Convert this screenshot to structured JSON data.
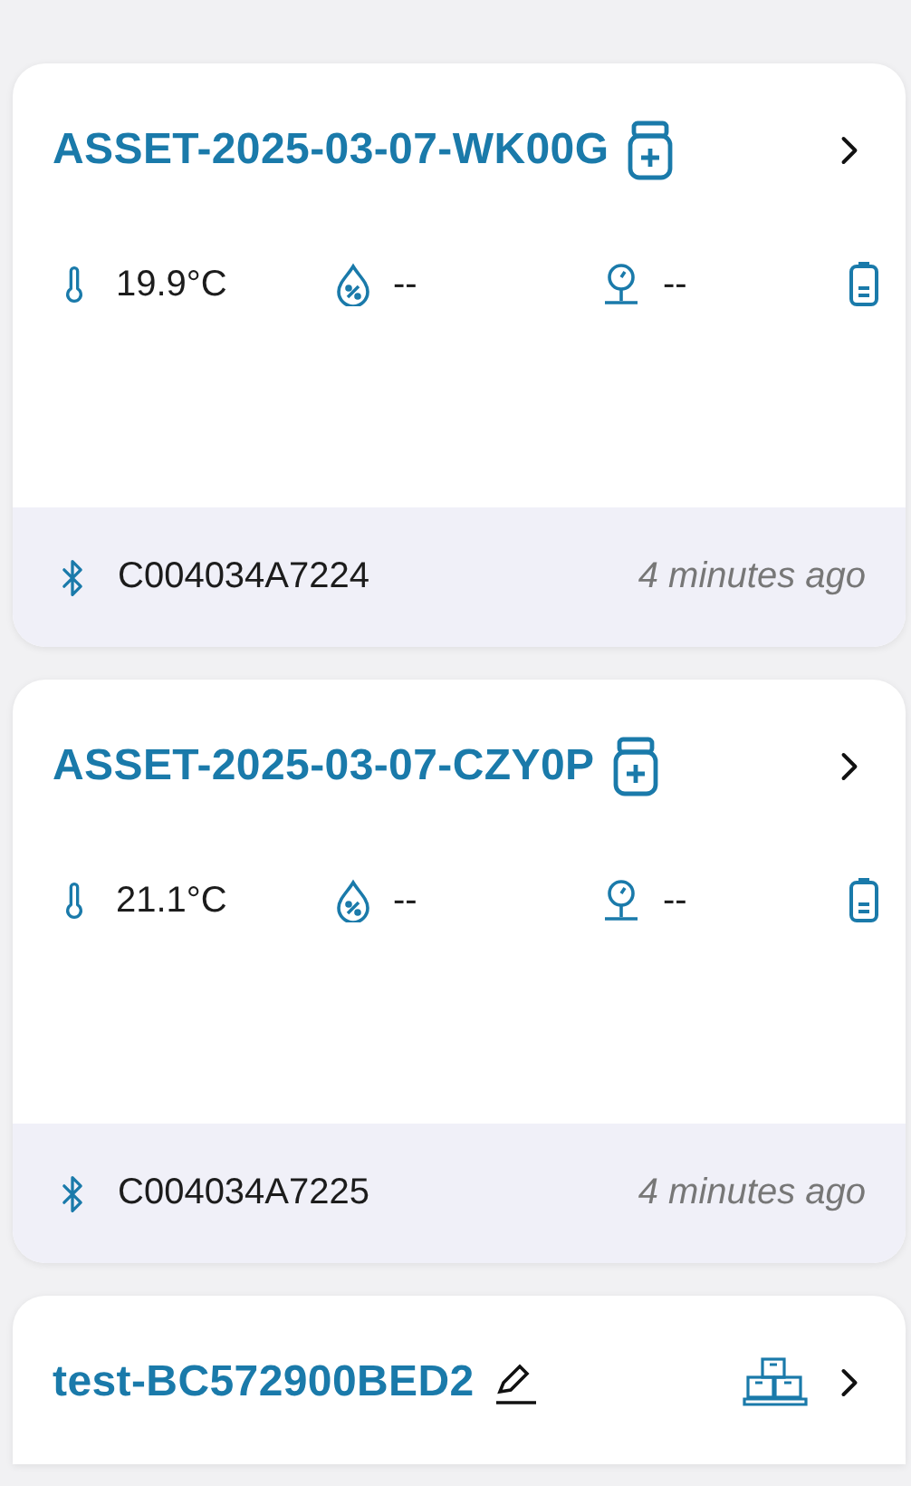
{
  "cards": [
    {
      "kind": "asset",
      "title": "ASSET-2025-03-07-WK00G",
      "sensors": [
        {
          "kind": "temperature",
          "value": "19.9°C"
        },
        {
          "kind": "humidity",
          "value": "--"
        },
        {
          "kind": "pressure",
          "value": "--"
        }
      ],
      "device_id": "C004034A7224",
      "updated": "4 minutes ago"
    },
    {
      "kind": "asset",
      "title": "ASSET-2025-03-07-CZY0P",
      "sensors": [
        {
          "kind": "temperature",
          "value": "21.1°C"
        },
        {
          "kind": "humidity",
          "value": "--"
        },
        {
          "kind": "pressure",
          "value": "--"
        }
      ],
      "device_id": "C004034A7225",
      "updated": "4 minutes ago"
    },
    {
      "kind": "group",
      "title": "test-BC572900BED2"
    }
  ]
}
